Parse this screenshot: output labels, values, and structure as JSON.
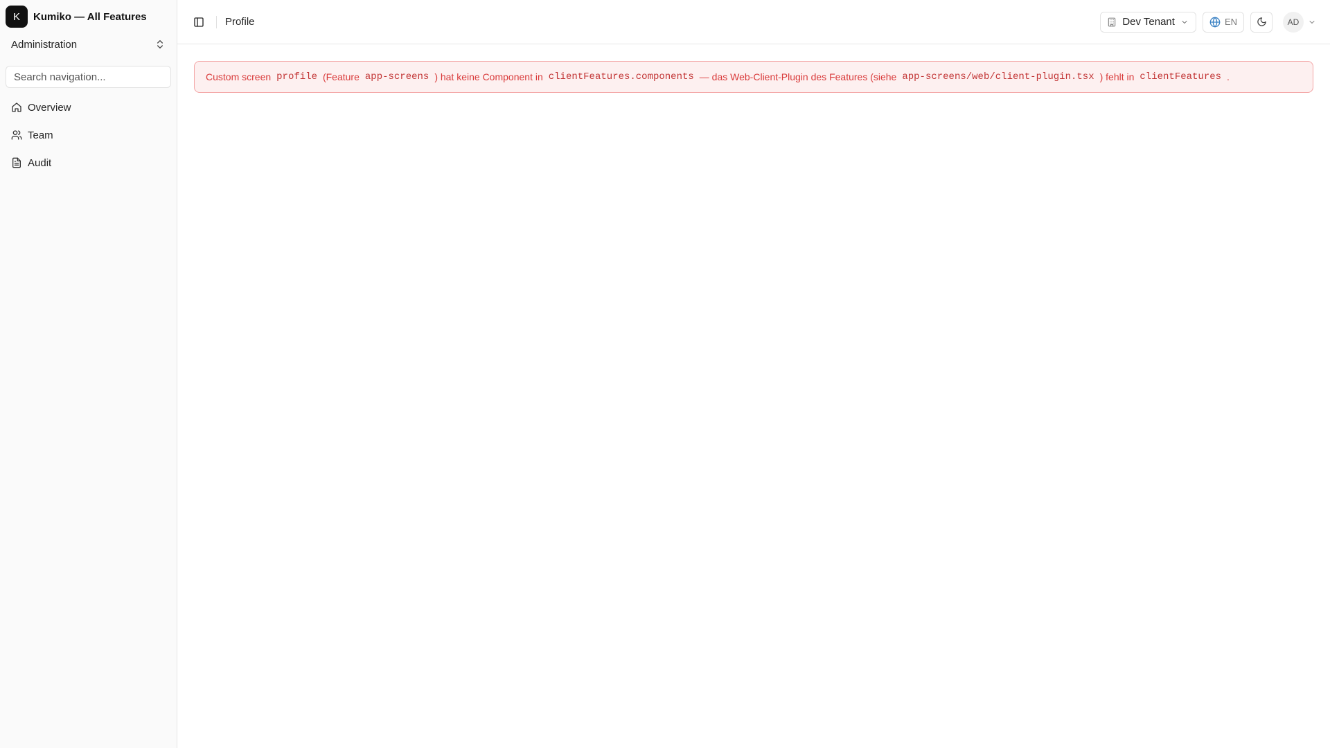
{
  "sidebar": {
    "logo_letter": "K",
    "app_name": "Kumiko — All Features",
    "section": "Administration",
    "search_placeholder": "Search navigation...",
    "items": [
      {
        "label": "Overview",
        "icon": "home-icon"
      },
      {
        "label": "Team",
        "icon": "users-icon"
      },
      {
        "label": "Audit",
        "icon": "file-text-icon"
      }
    ]
  },
  "header": {
    "title": "Profile",
    "tenant": "Dev Tenant",
    "language": "EN",
    "user_initials": "AD"
  },
  "error": {
    "t1": "Custom screen",
    "c1": "profile",
    "t2": "(Feature",
    "c2": "app-screens",
    "t3": ") hat keine Component in",
    "c3": "clientFeatures.components",
    "t4": "— das Web-Client-Plugin des Features (siehe",
    "c4": "app-screens/web/client-plugin.tsx",
    "t5": ") fehlt in",
    "c5": "clientFeatures",
    "t6": "."
  },
  "colors": {
    "error_text": "#d93a3a",
    "error_bg": "#fdf0f0",
    "error_border": "#f3a5a5",
    "sidebar_bg": "#fafafa"
  }
}
